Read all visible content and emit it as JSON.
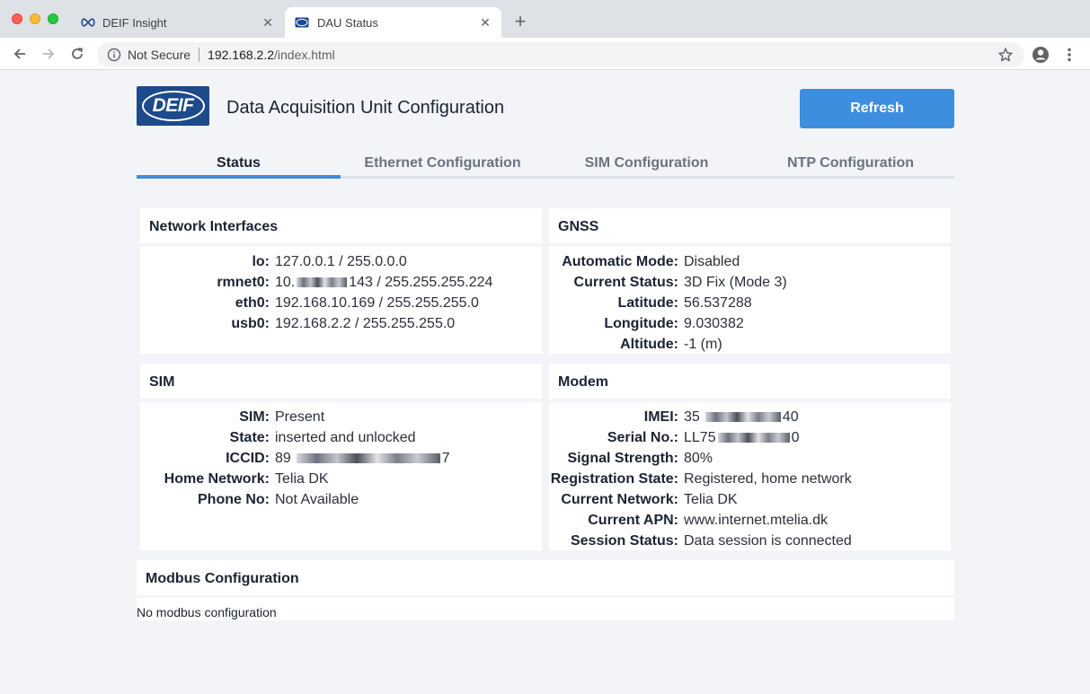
{
  "browser": {
    "tabs": [
      {
        "label": "DEIF Insight",
        "active": false
      },
      {
        "label": "DAU Status",
        "active": true
      }
    ],
    "security_label": "Not Secure",
    "url_host": "192.168.2.2",
    "url_path": "/index.html"
  },
  "header": {
    "logo_text": "DEIF",
    "title": "Data Acquisition Unit Configuration",
    "refresh_label": "Refresh"
  },
  "nav": {
    "tabs": [
      {
        "label": "Status",
        "selected": true
      },
      {
        "label": "Ethernet Configuration",
        "selected": false
      },
      {
        "label": "SIM Configuration",
        "selected": false
      },
      {
        "label": "NTP Configuration",
        "selected": false
      }
    ]
  },
  "network_interfaces": {
    "title": "Network Interfaces",
    "rows": [
      {
        "key": "lo:",
        "value": "127.0.0.1 / 255.0.0.0"
      },
      {
        "key": "rmnet0:",
        "value_prefix": "10.",
        "value_suffix": "143 / 255.255.255.224"
      },
      {
        "key": "eth0:",
        "value": "192.168.10.169 / 255.255.255.0"
      },
      {
        "key": "usb0:",
        "value": "192.168.2.2 / 255.255.255.0"
      }
    ]
  },
  "gnss": {
    "title": "GNSS",
    "rows": [
      {
        "key": "Automatic Mode:",
        "value": "Disabled"
      },
      {
        "key": "Current Status:",
        "value": "3D Fix (Mode 3)"
      },
      {
        "key": "Latitude:",
        "value": "56.537288"
      },
      {
        "key": "Longitude:",
        "value": "9.030382"
      },
      {
        "key": "Altitude:",
        "value": "-1 (m)"
      }
    ]
  },
  "sim": {
    "title": "SIM",
    "rows": [
      {
        "key": "SIM:",
        "value": "Present"
      },
      {
        "key": "State:",
        "value": "inserted and unlocked"
      },
      {
        "key": "ICCID:",
        "value_prefix": "89",
        "value_suffix": "7"
      },
      {
        "key": "Home Network:",
        "value": "Telia DK"
      },
      {
        "key": "Phone No:",
        "value": "Not Available"
      }
    ]
  },
  "modem": {
    "title": "Modem",
    "rows": [
      {
        "key": "IMEI:",
        "value_prefix": "35",
        "value_suffix": "40"
      },
      {
        "key": "Serial No.:",
        "value_prefix": "LL75",
        "value_suffix": "0"
      },
      {
        "key": "Signal Strength:",
        "value": "80%"
      },
      {
        "key": "Registration State:",
        "value": "Registered, home network"
      },
      {
        "key": "Current Network:",
        "value": "Telia DK"
      },
      {
        "key": "Current APN:",
        "value": "www.internet.mtelia.dk"
      },
      {
        "key": "Session Status:",
        "value": "Data session is connected"
      }
    ]
  },
  "modbus": {
    "title": "Modbus Configuration",
    "message": "No modbus configuration"
  },
  "colors": {
    "accent": "#3e8ee0",
    "logo": "#1c4a8a"
  }
}
